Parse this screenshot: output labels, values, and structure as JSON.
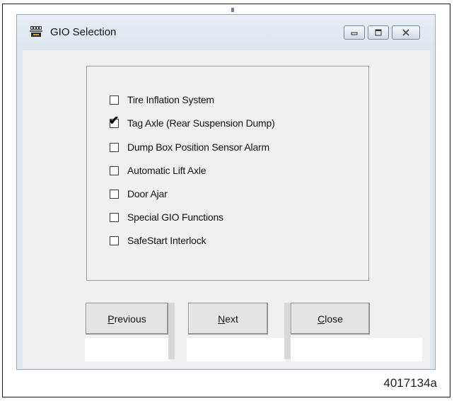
{
  "window": {
    "title": "GIO Selection",
    "icon": "gio-app-icon",
    "controls": {
      "minimize": "minimize-icon",
      "maximize": "maximize-icon",
      "close": "close-icon"
    }
  },
  "options": [
    {
      "label": "Tire Inflation System",
      "checked": false
    },
    {
      "label": "Tag Axle (Rear Suspension Dump)",
      "checked": true
    },
    {
      "label": "Dump Box Position Sensor Alarm",
      "checked": false
    },
    {
      "label": "Automatic Lift Axle",
      "checked": false
    },
    {
      "label": "Door Ajar",
      "checked": false
    },
    {
      "label": "Special GIO Functions",
      "checked": false
    },
    {
      "label": "SafeStart Interlock",
      "checked": false
    }
  ],
  "buttons": {
    "previous": {
      "label": "Previous",
      "mnemonic": "P"
    },
    "next": {
      "label": "Next",
      "mnemonic": "N"
    },
    "close": {
      "label": "Close",
      "mnemonic": "C"
    }
  },
  "figure_id": "4017134a"
}
